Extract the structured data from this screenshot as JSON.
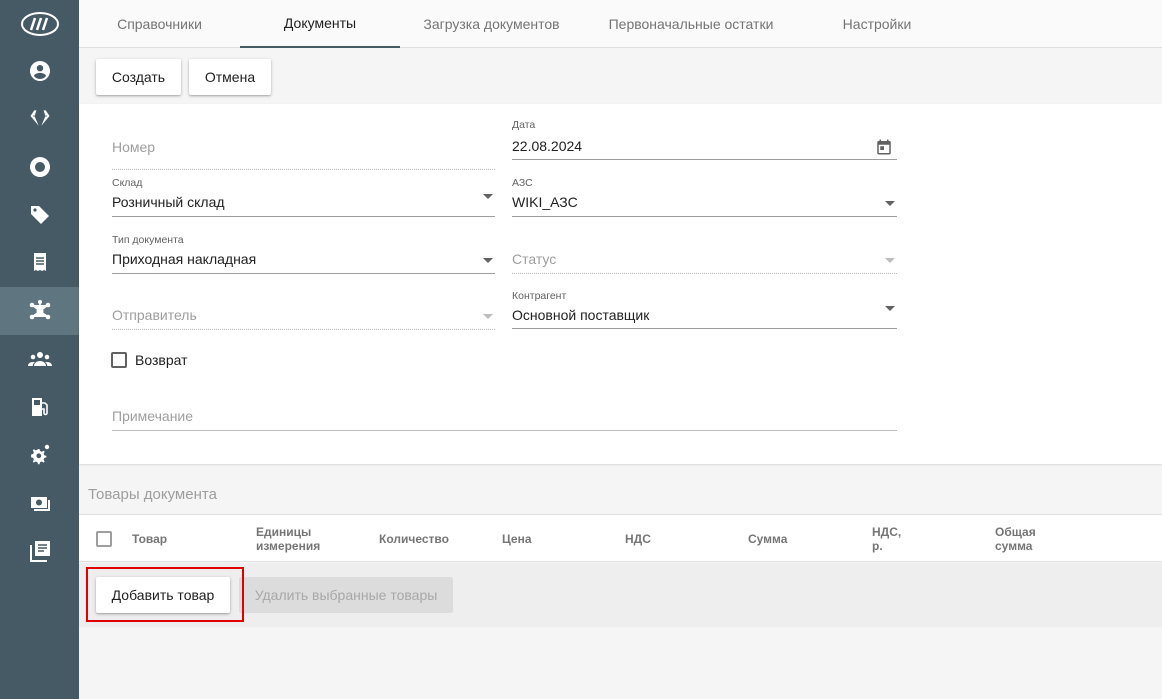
{
  "sidebar": {
    "items": [
      {
        "icon": "logo-icon"
      },
      {
        "icon": "account-icon"
      },
      {
        "icon": "diamond-icon"
      },
      {
        "icon": "lifebuoy-icon"
      },
      {
        "icon": "tags-icon"
      },
      {
        "icon": "receipt-icon"
      },
      {
        "icon": "network-icon",
        "active": true
      },
      {
        "icon": "users-icon"
      },
      {
        "icon": "fuel-pump-icon"
      },
      {
        "icon": "gears-icon"
      },
      {
        "icon": "cash-register-icon"
      },
      {
        "icon": "library-icon"
      }
    ]
  },
  "tabs": [
    {
      "label": "Справочники"
    },
    {
      "label": "Документы",
      "active": true
    },
    {
      "label": "Загрузка документов"
    },
    {
      "label": "Первоначальные остатки"
    },
    {
      "label": "Настройки"
    }
  ],
  "toolbar": {
    "create_label": "Создать",
    "cancel_label": "Отмена"
  },
  "form": {
    "number": {
      "placeholder": "Номер"
    },
    "date": {
      "label": "Дата",
      "value": "22.08.2024"
    },
    "warehouse": {
      "label": "Склад",
      "value": "Розничный склад"
    },
    "station": {
      "label": "АЗС",
      "value": "WIKI_АЗС"
    },
    "doc_type": {
      "label": "Тип документа",
      "value": "Приходная накладная"
    },
    "status": {
      "placeholder": "Статус"
    },
    "sender": {
      "placeholder": "Отправитель"
    },
    "counterparty": {
      "label": "Контрагент",
      "value": "Основной поставщик"
    },
    "return": {
      "label": "Возврат",
      "checked": false
    },
    "note": {
      "placeholder": "Примечание"
    }
  },
  "goods": {
    "title": "Товары документа",
    "columns": [
      {
        "line1": "Товар",
        "line2": ""
      },
      {
        "line1": "Единицы",
        "line2": "измерения"
      },
      {
        "line1": "Количество",
        "line2": ""
      },
      {
        "line1": "Цена",
        "line2": ""
      },
      {
        "line1": "НДС",
        "line2": ""
      },
      {
        "line1": "Сумма",
        "line2": ""
      },
      {
        "line1": "НДС,",
        "line2": "р."
      },
      {
        "line1": "Общая",
        "line2": "сумма"
      }
    ],
    "add_label": "Добавить товар",
    "delete_label": "Удалить выбранные товары"
  },
  "colors": {
    "sidebar_bg": "#455a64",
    "highlight": "#e00000"
  }
}
